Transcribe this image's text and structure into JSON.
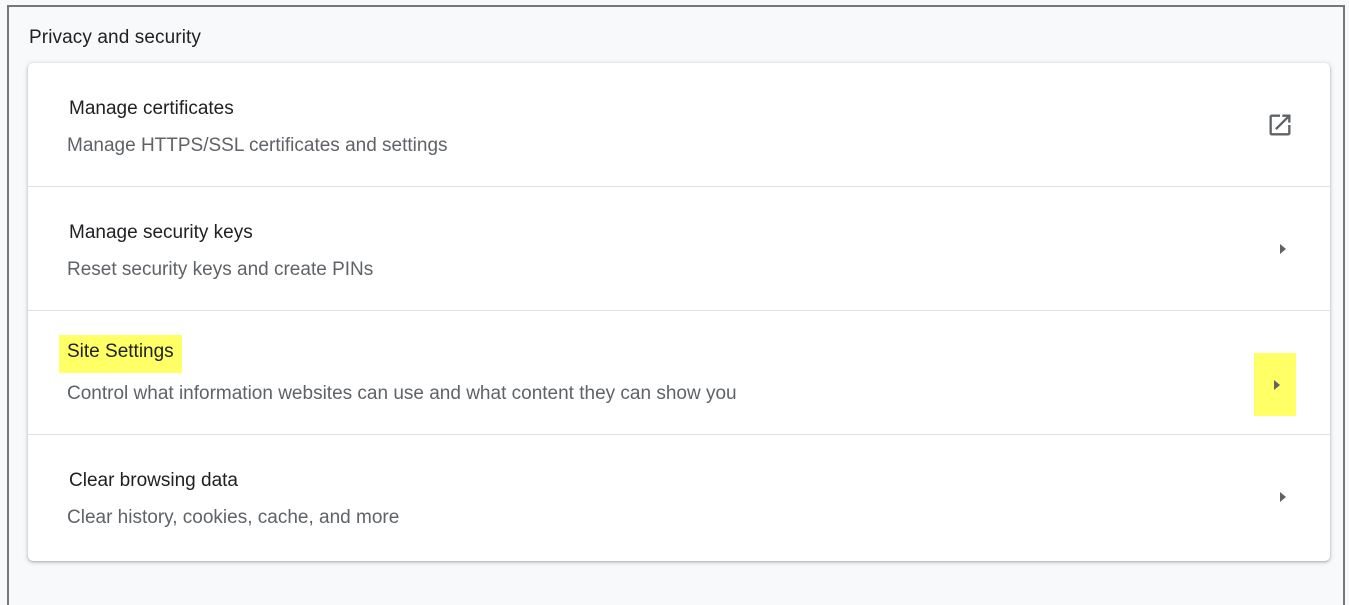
{
  "section": {
    "title": "Privacy and security"
  },
  "rows": [
    {
      "label": "Manage certificates",
      "sublabel": "Manage HTTPS/SSL certificates and settings",
      "icon": "open-in-new-icon"
    },
    {
      "label": "Manage security keys",
      "sublabel": "Reset security keys and create PINs",
      "icon": "arrow-right-icon"
    },
    {
      "label": "Site Settings",
      "sublabel": "Control what information websites can use and what content they can show you",
      "icon": "arrow-right-icon",
      "highlighted": true
    },
    {
      "label": "Clear browsing data",
      "sublabel": "Clear history, cookies, cache, and more",
      "icon": "arrow-right-icon"
    }
  ],
  "colors": {
    "highlight": "#ffff66",
    "primary_text": "#202124",
    "secondary_text": "#5f6368",
    "icon": "#5f6368"
  }
}
